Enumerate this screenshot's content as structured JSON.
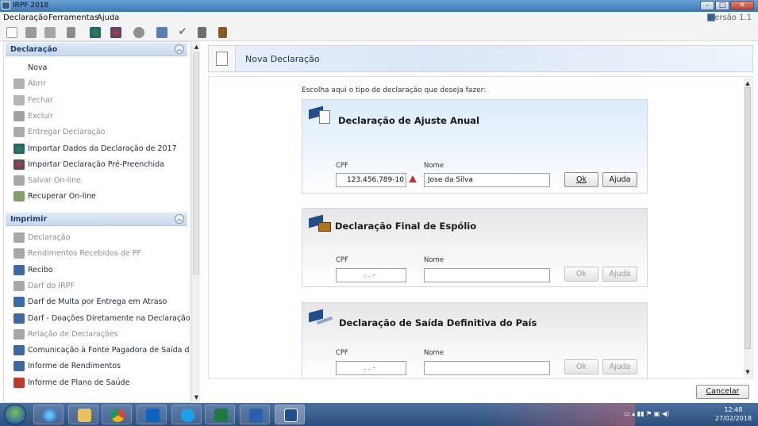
{
  "window": {
    "title": "IRPF 2018",
    "version": "Versão 1.1"
  },
  "menu": {
    "items": [
      "Declaração",
      "Ferramentas",
      "Ajuda"
    ]
  },
  "toolbar": {
    "icons": [
      "new-doc-icon",
      "open-folder-icon",
      "folder-icon",
      "trash-icon",
      "import-icon",
      "import-prefilled-icon",
      "cloud-icon",
      "print-icon",
      "check-icon",
      "calculator-icon",
      "book-icon"
    ]
  },
  "sidebar": {
    "declaracao": {
      "title": "Declaração",
      "items": [
        {
          "label": "Nova",
          "enabled": true
        },
        {
          "label": "Abrir",
          "enabled": false
        },
        {
          "label": "Fechar",
          "enabled": false
        },
        {
          "label": "Excluir",
          "enabled": false
        },
        {
          "label": "Entregar Declaração",
          "enabled": false
        },
        {
          "label": "Importar Dados da Declaração de 2017",
          "enabled": true
        },
        {
          "label": "Importar Declaração Pré-Preenchida",
          "enabled": true
        },
        {
          "label": "Salvar On-line",
          "enabled": false
        },
        {
          "label": "Recuperar On-line",
          "enabled": true
        }
      ]
    },
    "imprimir": {
      "title": "Imprimir",
      "items": [
        {
          "label": "Declaração",
          "enabled": false
        },
        {
          "label": "Rendimentos Recebidos de PF",
          "enabled": false
        },
        {
          "label": "Recibo",
          "enabled": true
        },
        {
          "label": "Darf do IRPF",
          "enabled": false
        },
        {
          "label": "Darf de Multa por Entrega em Atraso",
          "enabled": true
        },
        {
          "label": "Darf - Doações Diretamente na Declaração - ECA",
          "enabled": true
        },
        {
          "label": "Relação de Declarações",
          "enabled": false
        },
        {
          "label": "Comunicação à Fonte Pagadora de Saída do País",
          "enabled": true
        },
        {
          "label": "Informe de Rendimentos",
          "enabled": true
        },
        {
          "label": "Informe de Plano de Saúde",
          "enabled": true
        }
      ]
    }
  },
  "main": {
    "header_title": "Nova Declaração",
    "intro": "Escolha aqui o tipo de declaração que deseja fazer:",
    "cards": [
      {
        "title": "Declaração de Ajuste Anual",
        "cpf_label": "CPF",
        "nome_label": "Nome",
        "cpf_value": "123.456.789-10",
        "nome_value": "Jose da Silva",
        "ok": "Ok",
        "ajuda": "Ajuda",
        "active": true
      },
      {
        "title": "Declaração Final de Espólio",
        "cpf_label": "CPF",
        "nome_label": "Nome",
        "cpf_value": ". . -",
        "nome_value": "",
        "ok": "Ok",
        "ajuda": "Ajuda",
        "active": false
      },
      {
        "title": "Declaração de Saída Definitiva do País",
        "cpf_label": "CPF",
        "nome_label": "Nome",
        "cpf_value": ". . -",
        "nome_value": "",
        "ok": "Ok",
        "ajuda": "Ajuda",
        "active": false
      }
    ],
    "cancel": "Cancelar"
  },
  "taskbar": {
    "apps": [
      "internet-explorer-icon",
      "file-explorer-icon",
      "chrome-icon",
      "outlook-icon",
      "skype-icon",
      "excel-icon",
      "word-icon",
      "irpf-icon"
    ],
    "time": "12:48",
    "date": "27/02/2018"
  },
  "colors": {
    "accent": "#1f3f6a",
    "warning": "#d32f2f",
    "card_active_bg": "#eaf3fc"
  }
}
